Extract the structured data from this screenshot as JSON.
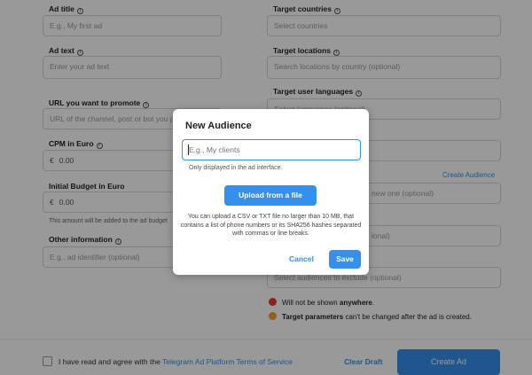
{
  "form": {
    "ad_title": {
      "label": "Ad title",
      "placeholder": "E.g., My first ad"
    },
    "ad_text": {
      "label": "Ad text",
      "placeholder": "Enter your ad text"
    },
    "url": {
      "label": "URL you want to promote",
      "placeholder": "URL of the channel, post or bot you p"
    },
    "cpm": {
      "label": "CPM in Euro",
      "currency": "€",
      "value": "0.00"
    },
    "budget": {
      "label": "Initial Budget in Euro",
      "currency": "€",
      "value": "0.00",
      "note": "This amount will be added to the ad budget"
    },
    "other": {
      "label": "Other information",
      "placeholder": "E.g., ad identifier (optional)"
    },
    "target_countries": {
      "label": "Target countries",
      "placeholder": "Select countries"
    },
    "target_locations": {
      "label": "Target locations",
      "placeholder": "Search locations by country (optional)"
    },
    "target_languages": {
      "label": "Target user languages",
      "placeholder": "Select languages (optional)"
    },
    "create_audience": "Create Audience",
    "audience_field": {
      "placeholder": "new one (optional)"
    },
    "optional_field": {
      "placeholder": "ional)"
    },
    "exclude_field": {
      "placeholder": "Select audiences to exclude (optional)"
    },
    "warn1": {
      "text": "Will not be shown ",
      "bold": "anywhere",
      "suffix": "."
    },
    "warn2": {
      "bold": "Target parameters",
      "text": " can't be changed after the ad is created."
    }
  },
  "footer": {
    "agree_prefix": "I have read and agree with the ",
    "agree_link": "Telegram Ad Platform Terms of Service",
    "clear_draft": "Clear Draft",
    "create_ad": "Create Ad"
  },
  "modal": {
    "title": "New Audience",
    "input_placeholder": "E.g., My clients",
    "hint": "Only displayed in the ad interface.",
    "upload_label": "Upload from a file",
    "description": "You can upload a CSV or TXT file no larger than 10 MB, that contains a list of phone numbers or its SHA256 hashes separated with commas or line breaks.",
    "cancel_label": "Cancel",
    "save_label": "Save"
  },
  "colors": {
    "accent": "#3390ec",
    "warn_red": "#e53935",
    "warn_orange": "#f0a030"
  },
  "icons": [
    "info-icon",
    "no-entry-icon",
    "warning-icon"
  ]
}
